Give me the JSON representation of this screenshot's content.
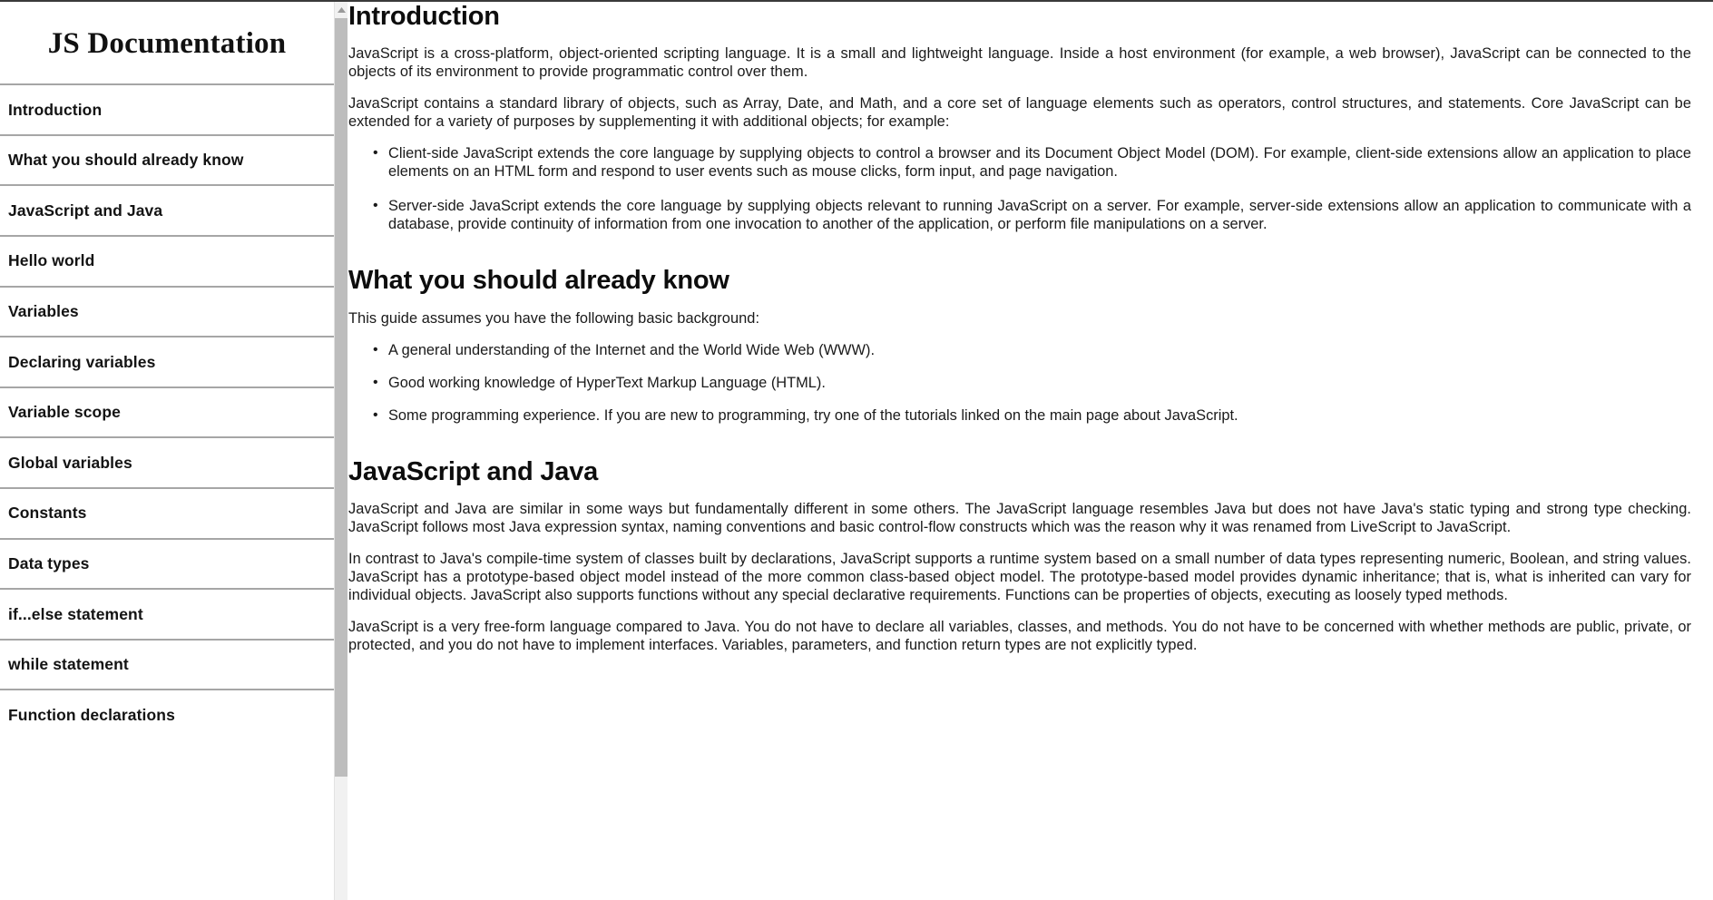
{
  "sidebar": {
    "title": "JS Documentation",
    "items": [
      {
        "label": "Introduction"
      },
      {
        "label": "What you should already know"
      },
      {
        "label": "JavaScript and Java"
      },
      {
        "label": "Hello world"
      },
      {
        "label": "Variables"
      },
      {
        "label": "Declaring variables"
      },
      {
        "label": "Variable scope"
      },
      {
        "label": "Global variables"
      },
      {
        "label": "Constants"
      },
      {
        "label": "Data types"
      },
      {
        "label": "if...else statement"
      },
      {
        "label": "while statement"
      },
      {
        "label": "Function declarations"
      }
    ],
    "scrollbar": {
      "arrow_up_icon": "triangle-up-icon",
      "track_color": "#f1f1f1",
      "thumb_color": "#bdbdbd"
    }
  },
  "main": {
    "sections": [
      {
        "id": "introduction",
        "title": "Introduction",
        "paragraphs": [
          "JavaScript is a cross-platform, object-oriented scripting language. It is a small and lightweight language. Inside a host environment (for example, a web browser), JavaScript can be connected to the objects of its environment to provide programmatic control over them.",
          "JavaScript contains a standard library of objects, such as Array, Date, and Math, and a core set of language elements such as operators, control structures, and statements. Core JavaScript can be extended for a variety of purposes by supplementing it with additional objects; for example:"
        ],
        "bullets": [
          "Client-side JavaScript extends the core language by supplying objects to control a browser and its Document Object Model (DOM). For example, client-side extensions allow an application to place elements on an HTML form and respond to user events such as mouse clicks, form input, and page navigation.",
          "Server-side JavaScript extends the core language by supplying objects relevant to running JavaScript on a server. For example, server-side extensions allow an application to communicate with a database, provide continuity of information from one invocation to another of the application, or perform file manipulations on a server."
        ],
        "paragraphs_after": []
      },
      {
        "id": "what-you-should-already-know",
        "title": "What you should already know",
        "paragraphs": [
          "This guide assumes you have the following basic background:"
        ],
        "bullets": [
          "A general understanding of the Internet and the World Wide Web (WWW).",
          "Good working knowledge of HyperText Markup Language (HTML).",
          "Some programming experience. If you are new to programming, try one of the tutorials linked on the main page about JavaScript."
        ],
        "paragraphs_after": []
      },
      {
        "id": "javascript-and-java",
        "title": "JavaScript and Java",
        "paragraphs": [
          "JavaScript and Java are similar in some ways but fundamentally different in some others. The JavaScript language resembles Java but does not have Java's static typing and strong type checking. JavaScript follows most Java expression syntax, naming conventions and basic control-flow constructs which was the reason why it was renamed from LiveScript to JavaScript.",
          "In contrast to Java's compile-time system of classes built by declarations, JavaScript supports a runtime system based on a small number of data types representing numeric, Boolean, and string values. JavaScript has a prototype-based object model instead of the more common class-based object model. The prototype-based model provides dynamic inheritance; that is, what is inherited can vary for individual objects. JavaScript also supports functions without any special declarative requirements. Functions can be properties of objects, executing as loosely typed methods.",
          "JavaScript is a very free-form language compared to Java. You do not have to declare all variables, classes, and methods. You do not have to be concerned with whether methods are public, private, or protected, and you do not have to implement interfaces. Variables, parameters, and function return types are not explicitly typed."
        ],
        "bullets": [],
        "paragraphs_after": []
      }
    ]
  },
  "bullet_glyph": "•",
  "colors": {
    "text": "#1a1a1a",
    "heading": "#0d0d0d",
    "divider": "#a6a6a6",
    "scrollbar_thumb": "#bdbdbd",
    "background": "#ffffff"
  }
}
